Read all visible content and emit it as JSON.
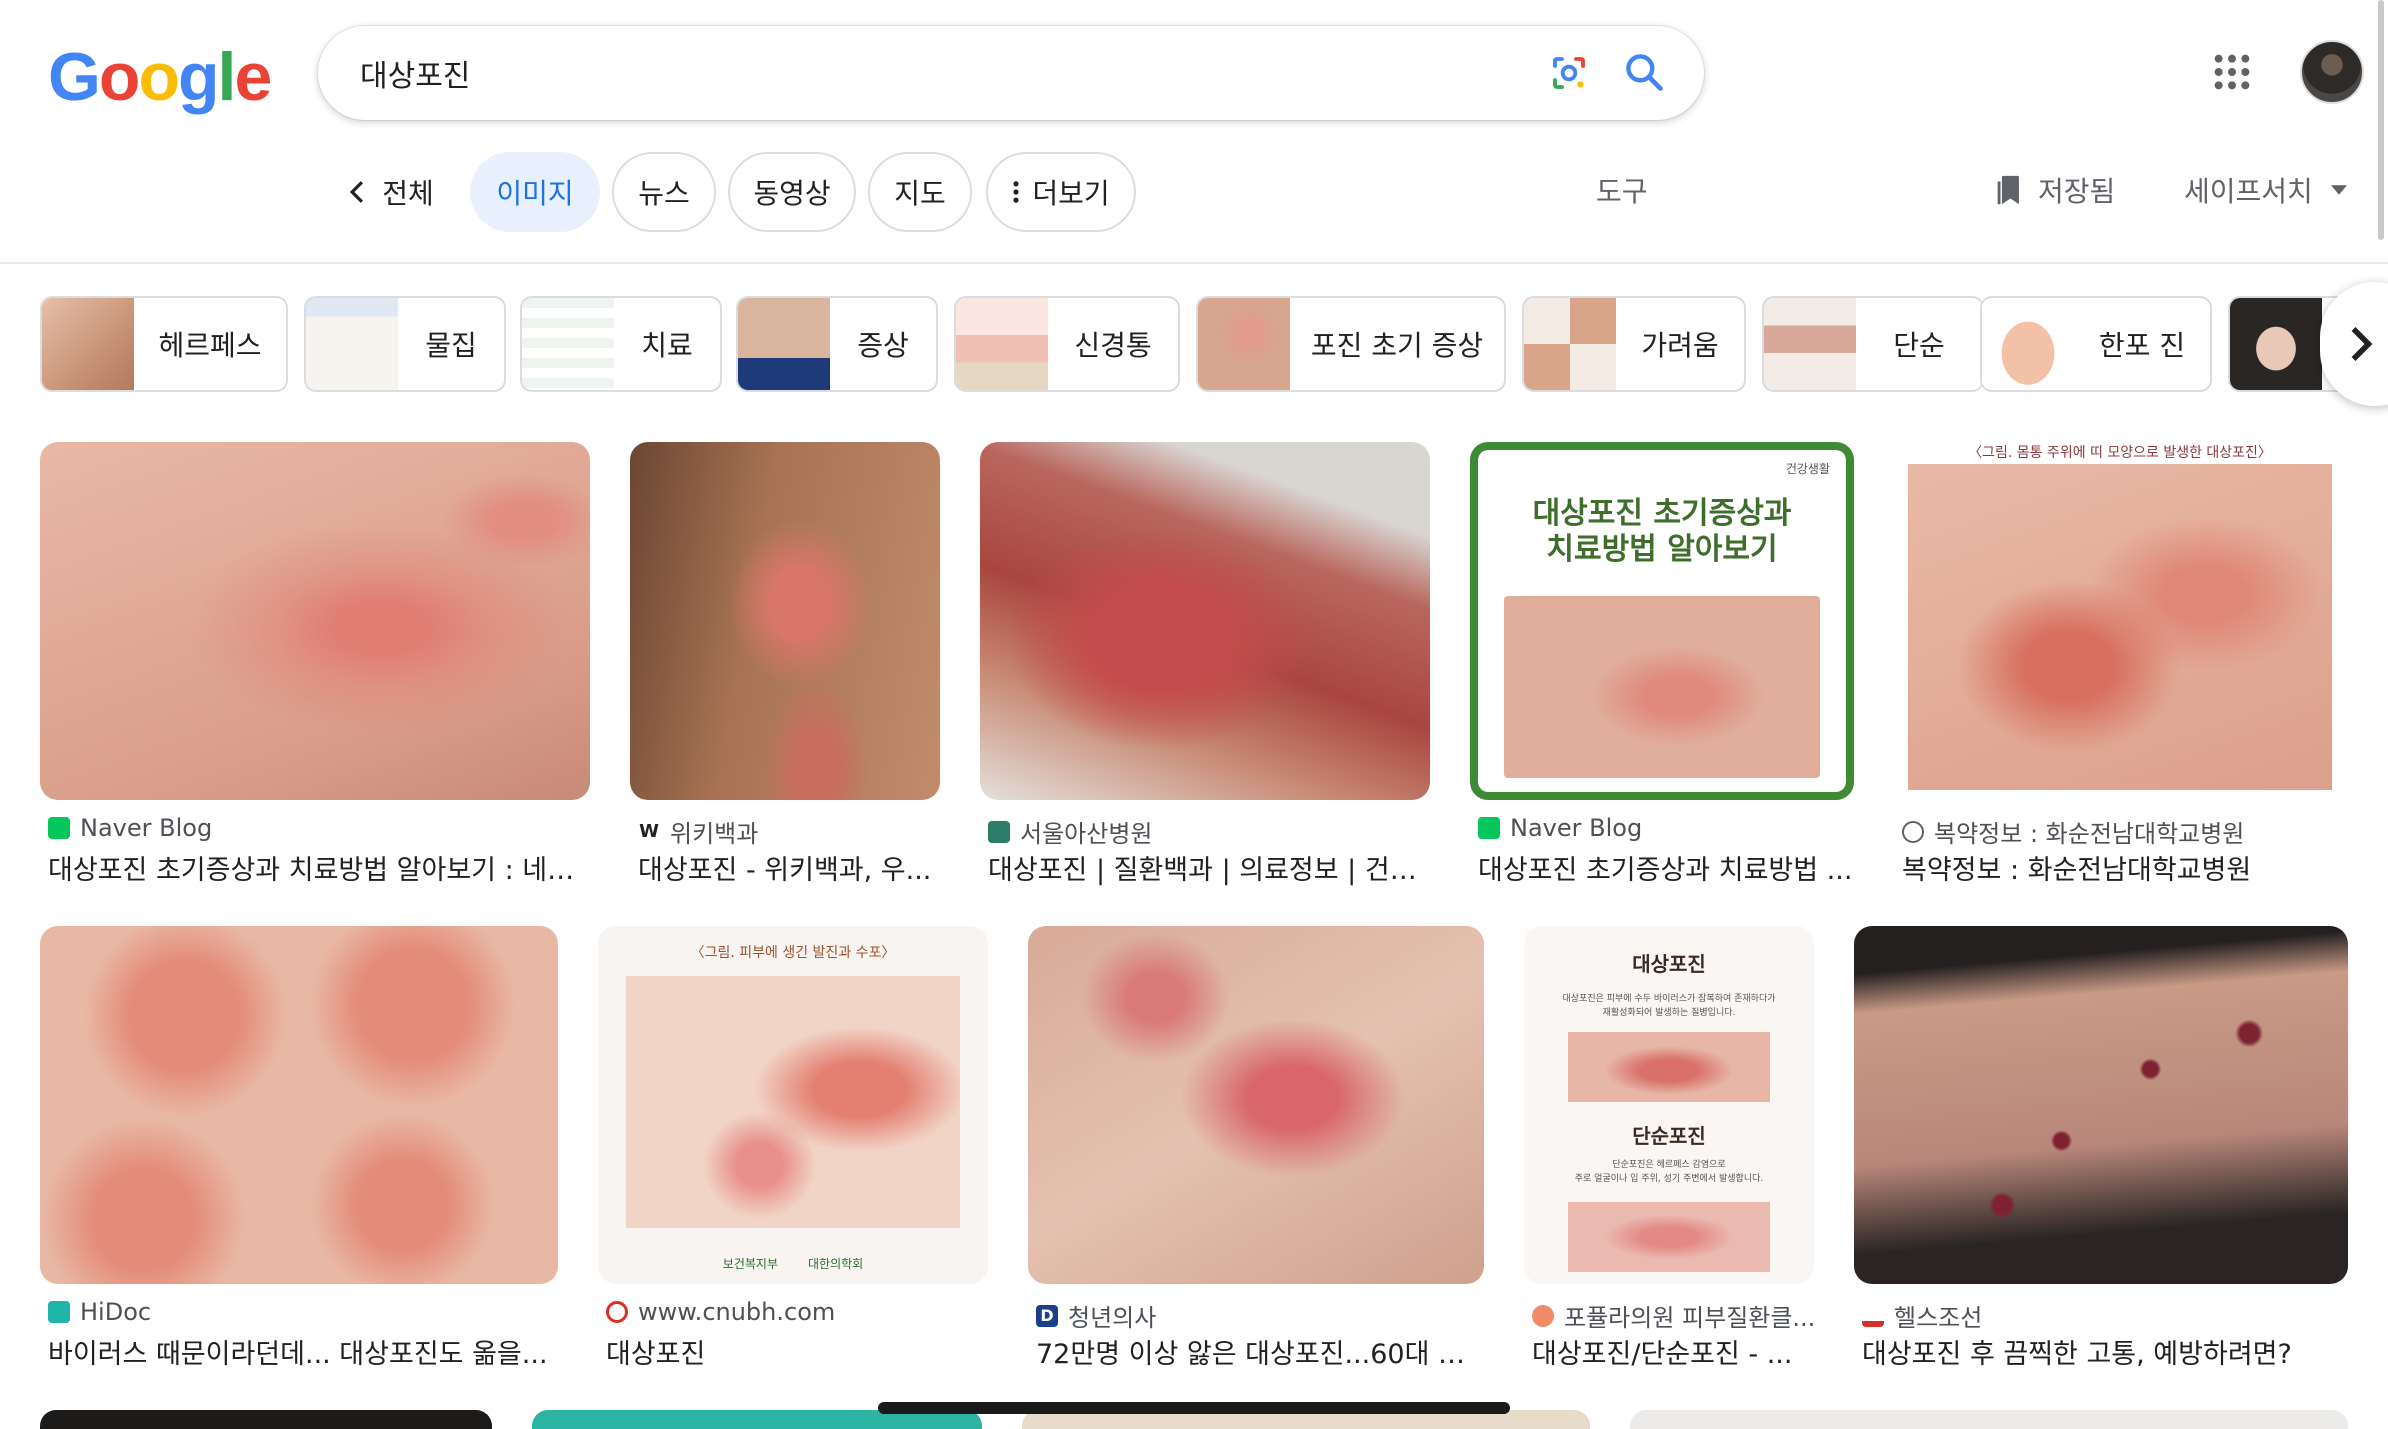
{
  "logo_letters": [
    {
      "ch": "G",
      "color": "#4285F4"
    },
    {
      "ch": "o",
      "color": "#EA4335"
    },
    {
      "ch": "o",
      "color": "#FBBC05"
    },
    {
      "ch": "g",
      "color": "#4285F4"
    },
    {
      "ch": "l",
      "color": "#34A853"
    },
    {
      "ch": "e",
      "color": "#EA4335"
    }
  ],
  "search": {
    "query": "대상포진"
  },
  "tabs": {
    "all": "전체",
    "images": "이미지",
    "news": "뉴스",
    "videos": "동영상",
    "maps": "지도",
    "more": "더보기"
  },
  "tools": "도구",
  "saved": "저장됨",
  "safesearch": "세이프서치",
  "chips": [
    "헤르페스",
    "물집",
    "치료",
    "증상",
    "신경통",
    "포진 초기 증상",
    "가려움",
    "단순",
    "한포 진"
  ],
  "results": [
    {
      "source": "Naver Blog",
      "title": "대상포진 초기증상과 치료방법 알아보기 : 네이...",
      "favicon_color": "#03c75a"
    },
    {
      "source": "위키백과",
      "title": "대상포진 - 위키백과, 우...",
      "favicon_color": "#ffffff"
    },
    {
      "source": "서울아산병원",
      "title": "대상포진 | 질환백과 | 의료정보 | 건강...",
      "favicon_color": "#2e7d6b"
    },
    {
      "source": "Naver Blog",
      "title": "대상포진 초기증상과 치료방법 ...",
      "favicon_color": "#03c75a"
    },
    {
      "source": "복약정보 : 화순전남대학교병원",
      "title": "복약정보 : 화순전남대학교병원",
      "favicon_color": "#5f6368"
    },
    {
      "source": "HiDoc",
      "title": "바이러스 때문이라던데... 대상포진도 옮을...",
      "favicon_color": "#1fb5a9"
    },
    {
      "source": "www.cnubh.com",
      "title": "대상포진",
      "favicon_color": "#d93025"
    },
    {
      "source": "청년의사",
      "title": "72만명 이상 앓은 대상포진...60대 환...",
      "favicon_color": "#1a3f8c"
    },
    {
      "source": "포퓰라의원 피부질환클...",
      "title": "대상포진/단순포진 - ...",
      "favicon_color": "#f28b6a"
    },
    {
      "source": "헬스조선",
      "title": "대상포진 후 끔찍한 고통, 예방하려면?",
      "favicon_color": "#d93025"
    }
  ],
  "image_text": {
    "card4_tag": "건강생활",
    "card4_title_line1": "대상포진 초기증상과",
    "card4_title_line2": "치료방법 알아보기",
    "card5_caption": "〈그림. 몸통 주위에 띠 모양으로 발생한 대상포진〉",
    "card7_caption": "〈그림. 피부에 생긴 발진과 수포〉",
    "card7_footer_left": "보건복지부",
    "card7_footer_right": "대한의학회",
    "card9_heading1": "대상포진",
    "card9_text1": "대상포진은 피부에 수두 바이러스가 잠복하여 존재하다가",
    "card9_text2": "재활성화되어 발생하는 질병입니다.",
    "card9_heading2": "단순포진",
    "card9_text3": "단순포진은 헤르페스 감염으로",
    "card9_text4": "주로 얼굴이나 입 주위, 성기 주변에서 발생합니다."
  }
}
